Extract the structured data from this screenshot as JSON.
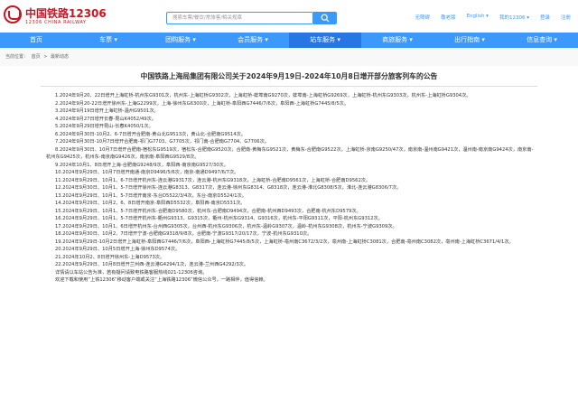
{
  "header": {
    "logo_name": "中国铁路12306",
    "logo_sub": "12306 CHINA RAILWAY",
    "search_placeholder": "搜索车票/餐饮/常旅客/相关规章",
    "links": [
      "无障碍",
      "敬老版",
      "English ▾",
      "我的12306 ▾",
      "登录",
      "注册"
    ]
  },
  "nav": [
    "首页",
    "车票 ▾",
    "团购服务 ▾",
    "会员服务 ▾",
    "站车服务 ▾",
    "商旅服务 ▾",
    "出行指南 ▾",
    "信息查询 ▾"
  ],
  "nav_active_index": 4,
  "breadcrumb": [
    "当前位置：",
    "首页",
    ">",
    "最新动态"
  ],
  "article": {
    "title": "中国铁路上海局集团有限公司关于2024年9月19日-2024年10月8日增开部分旅客列车的公告",
    "paragraphs": [
      "1.2024年9月20、22日增开上海虹桥-杭州东G9301次，杭州东-上海虹桥G9302次，上海虹桥-蚌埠南G9270次，蚌埠南-上海虹桥G9269次，上海虹桥-杭州东G9303次，杭州东-上海虹桥G9304次。",
      "2.2024年9月20-22日增开徐州东-上海G2299次，上海-徐州东G6300次，上海虹桥-阜阳西G7446/7/6次，阜阳西-上海虹桥G7445/8/5次。",
      "3.2024年9月19日增开上海虹桥-温州G9501次。",
      "4.2024年9月27日增开长春-昆山K4052/49次。",
      "5.2024年9月29日增开昆山-长春K4050/1次。",
      "6.2024年9月30日-10月2、6-7日增开合肥南-黄山北G9513次，黄山北-合肥南G9514次。",
      "7.2024年9月30日-10月7日增开合肥南-祁门G7703、G7705次，祁门南-合肥南G7704、G7706次。",
      "8.2024年9月30日、10月7日增开合肥南-宿松东G9519次，宿松东-合肥南G9520次，合肥南-黄梅东G9521次，黄梅东-合肥南G9522次，上海虹桥-京南G9250/47次，南京南-温州南G9421次，温州南-南京南G9424次，南京南-杭州东G9425次，杭州东-南京南G9426次，南京南-阜阳西G9529/8次。",
      "9.2024年10月1、8日增开上海-合肥南G9248/9次，阜阳西-南京南G9527/30次。",
      "10.2024年9月29日、10月7日增开南通-南京D9496/5/6次，南京-南通D9497/6/7次。",
      "11.2024年9月29日、10月1、6-7日增开杭州东-连云港G9317次，连云港-杭州东G9318次，上海虹桥-合肥南D9561次，上海虹桥-合肥南D9562次。",
      "12.2024年9月30日、10月1、5-7日增开徐州东-连云港G8313、G8317次，连云港-徐州东G8314、G8318次，连云港-淮北G8308/5次，淮北-连云港G8306/7次。",
      "13.2024年9月29日、10月1、5-7日增开南京-东台D5522/3/4次，东台-南京D5524/1次。",
      "14.2024年9月29日、10月2、6、8日增开南京-阜阳西D5532次，阜阳西-南京D5531次。",
      "15.2024年9月29日、10月1、5-7日增开杭州东-合肥南D9580次，杭州东-合肥南D9494次，合肥南-杭州西D9493次，合肥南-杭州东D9579次。",
      "16.2024年9月29日、10月1、5-7日增开杭州东-衢州G9313、G9315次，衢州-杭州东G9314、G9316次，杭州东-平阳G9311次，平阳-杭州东G9312次。",
      "17.2024年9月29日、10月1、6日增开杭州东-台州西G9305次，台州西-杭州东G9306次，杭州东-温岭G9307次，温岭-杭州东G9308次，杭州东-宁波G9309次。",
      "18.2024年9月30日、10月2、7日增开宁波-合肥南G9318/9/8次，合肥南-宁波G9317/20/17次，宁波-杭州东G9310次。",
      "19.2024年9月29日-10月2日增开上海虹桥-阜阳西G7446/7/6次，阜阳西-上海虹桥G7445/8/5次，上海虹桥-亳州南C3672/3/2次，亳州南-上海虹桥C3081次，合肥南-亳州南C3082次，亳州南-上海虹桥C3671/4/1次。",
      "20.2024年9月29日、10月5日增开上海-徐州东D9574次。",
      "21.2024年10月2、8日增开徐州东-上海D9573次。",
      "22.2024年9月29日、10月8日增开兰州西-连云港G4294/1次，连云港-兰州西G4292/3次。",
      "详情请以车站公告为准，若有疑问请致电铁路客服热线021-12306咨询。",
      "欢迎下载和使用“上铁12306”移动客户端或关注“上海铁路12306”微信公众号，一路相伴，值得信赖。"
    ]
  }
}
